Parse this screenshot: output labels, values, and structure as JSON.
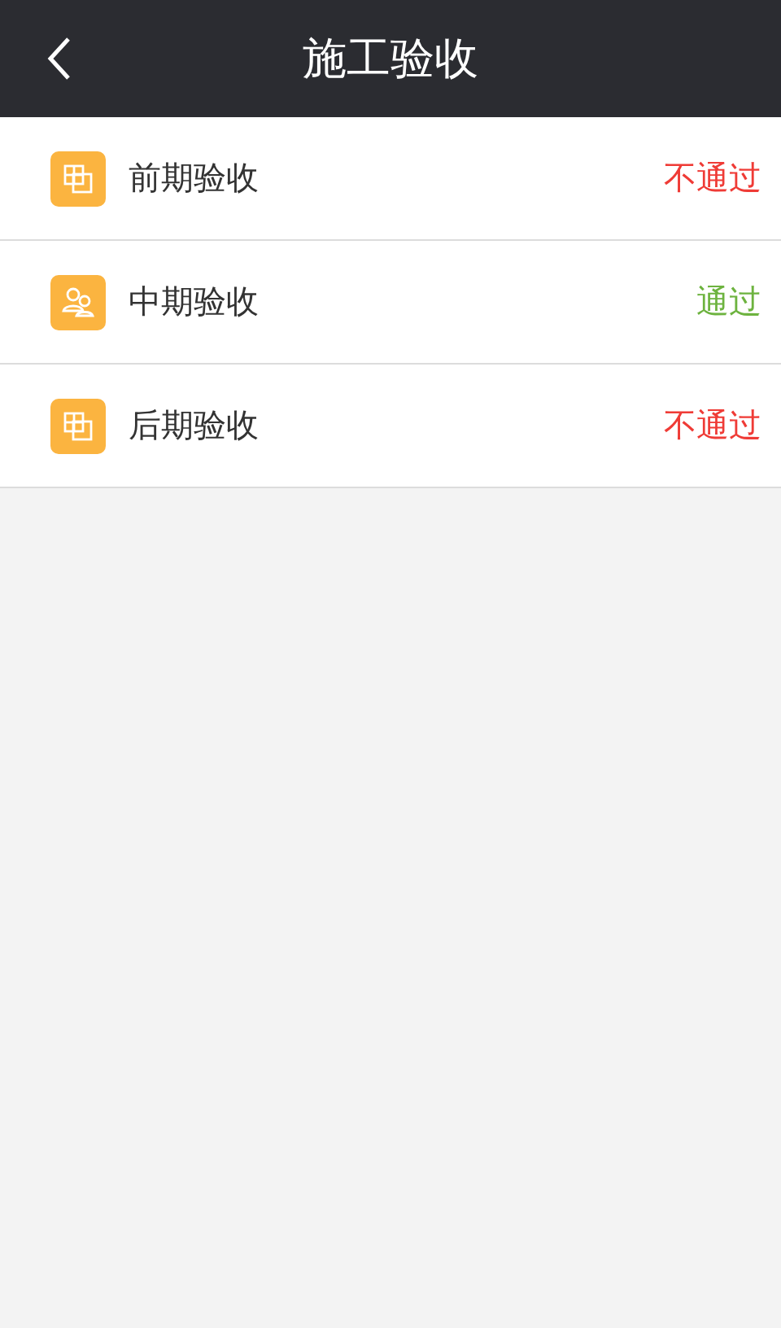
{
  "header": {
    "title": "施工验收"
  },
  "items": [
    {
      "label": "前期验收",
      "kind": "blocks",
      "status": "不通过",
      "passed": false
    },
    {
      "label": "中期验收",
      "kind": "people",
      "status": "通过",
      "passed": true
    },
    {
      "label": "后期验收",
      "kind": "blocks",
      "status": "不通过",
      "passed": false
    }
  ]
}
